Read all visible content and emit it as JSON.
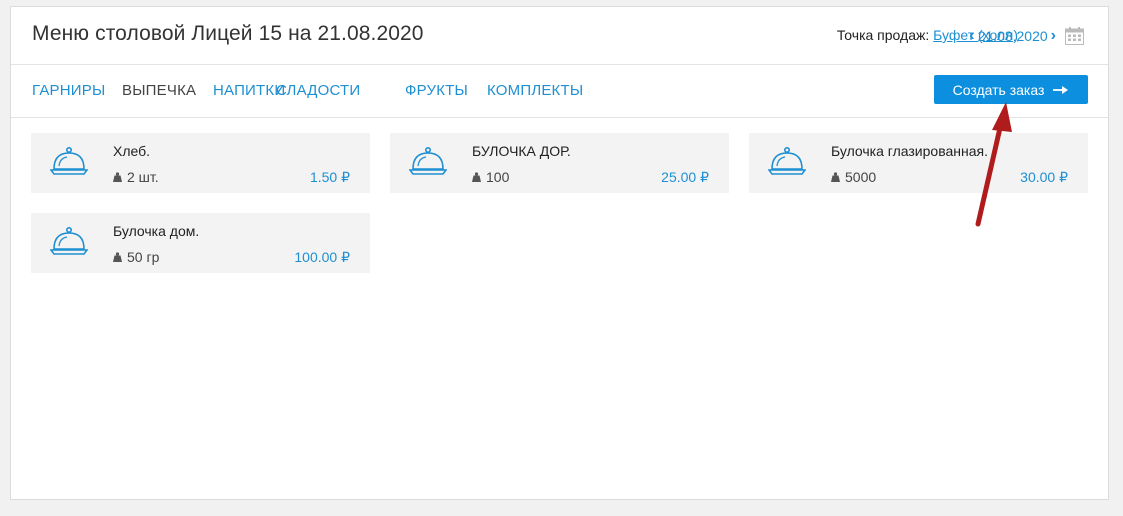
{
  "header": {
    "title": "Меню столовой Лицей 15 на 21.08.2020",
    "point_label": "Точка продаж:",
    "point_value": "Буфет (холл)",
    "date": "21.08.2020"
  },
  "tabs": [
    {
      "label": "ГАРНИРЫ",
      "active": false
    },
    {
      "label": "ВЫПЕЧКА",
      "active": true
    },
    {
      "label": "НАПИТКИ",
      "active": false
    },
    {
      "label": "СЛАДОСТИ",
      "active": false
    },
    {
      "label": "ФРУКТЫ",
      "active": false
    },
    {
      "label": "КОМПЛЕКТЫ",
      "active": false
    }
  ],
  "create_order_label": "Создать заказ",
  "items": [
    {
      "name": "Хлеб.",
      "weight": "2 шт.",
      "price": "1.50 ₽"
    },
    {
      "name": "БУЛОЧКА ДОР.",
      "weight": "100",
      "price": "25.00 ₽"
    },
    {
      "name": "Булочка глазированная.",
      "weight": "5000",
      "price": "30.00 ₽"
    },
    {
      "name": "Булочка дом.",
      "weight": "50 гр",
      "price": "100.00 ₽"
    }
  ],
  "colors": {
    "accent": "#1e8fd2",
    "button": "#0d8fe0",
    "annotation": "#b01c1c"
  }
}
